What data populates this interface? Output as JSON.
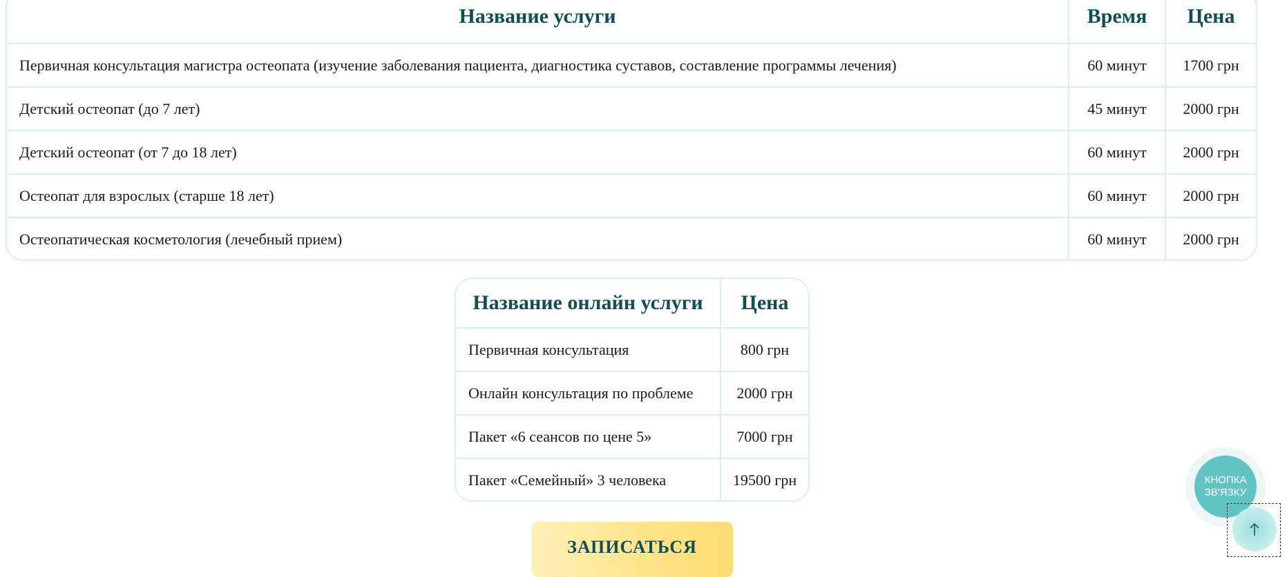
{
  "main_table": {
    "headers": [
      "Название услуги",
      "Время",
      "Цена"
    ],
    "rows": [
      [
        "Первичная консультация магистра остеопата (изучение заболевания пациента, диагностика суставов, составление программы лечения)",
        "60 минут",
        "1700 грн"
      ],
      [
        "Детский остеопат (до 7 лет)",
        "45 минут",
        "2000 грн"
      ],
      [
        "Детский остеопат (от 7 до 18 лет)",
        "60 минут",
        "2000 грн"
      ],
      [
        "Остеопат для взрослых (старше 18 лет)",
        "60 минут",
        "2000 грн"
      ],
      [
        "Остеопатическая косметология (лечебный прием)",
        "60 минут",
        "2000 грн"
      ]
    ]
  },
  "online_table": {
    "headers": [
      "Название онлайн услуги",
      "Цена"
    ],
    "rows": [
      [
        "Первичная консультация",
        "800 грн"
      ],
      [
        "Онлайн консультация по проблеме",
        "2000 грн"
      ],
      [
        "Пакет «6 сеансов по цене 5»",
        "7000 грн"
      ],
      [
        "Пакет «Семейный» 3 человека",
        "19500 грн"
      ]
    ]
  },
  "book_button": {
    "label": "ЗАПИСАТЬСЯ"
  },
  "contact_button": {
    "label": "КНОПКА\nЗВ'ЯЗКУ"
  },
  "scroll_top": {
    "icon": "arrow-up-icon"
  },
  "colors": {
    "heading": "#104e57",
    "border": "#d6f0f2",
    "accent": "#62c4c2",
    "button_gradient_start": "#fff0b8",
    "button_gradient_end": "#ffdc72"
  }
}
